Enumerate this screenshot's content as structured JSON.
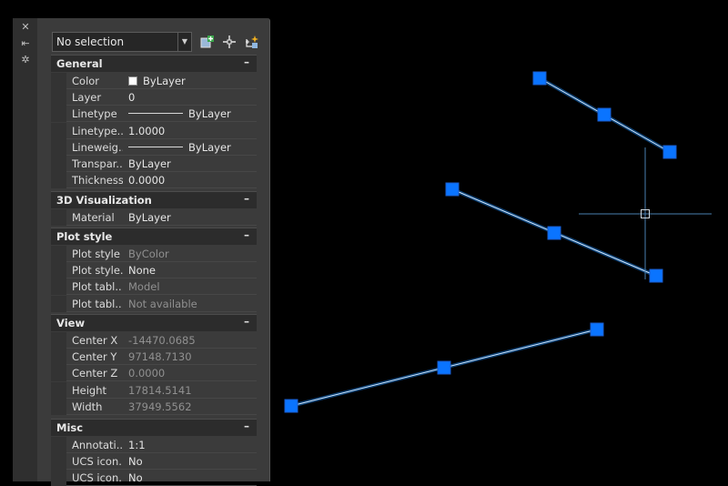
{
  "palette": {
    "titlebar_icons": [
      "close-icon",
      "auto-hide-icon",
      "properties-settings-icon"
    ],
    "selection": "No selection",
    "tools": [
      "toggle-pickadd-icon",
      "select-objects-icon",
      "quick-select-icon"
    ],
    "sections": [
      {
        "title": "General",
        "collapse": "–",
        "rows": [
          {
            "name": "Color",
            "value": "ByLayer",
            "swatch": true
          },
          {
            "name": "Layer",
            "value": "0"
          },
          {
            "name": "Linetype",
            "value": "ByLayer",
            "line": true
          },
          {
            "name": "Linetype...",
            "value": "1.0000"
          },
          {
            "name": "Lineweig...",
            "value": "ByLayer",
            "line": true
          },
          {
            "name": "Transpar...",
            "value": "ByLayer"
          },
          {
            "name": "Thickness",
            "value": "0.0000"
          }
        ]
      },
      {
        "title": "3D Visualization",
        "collapse": "–",
        "rows": [
          {
            "name": "Material",
            "value": "ByLayer"
          }
        ]
      },
      {
        "title": "Plot style",
        "collapse": "–",
        "rows": [
          {
            "name": "Plot style",
            "value": "ByColor",
            "dim": true
          },
          {
            "name": "Plot style...",
            "value": "None"
          },
          {
            "name": "Plot tabl...",
            "value": "Model",
            "dim": true
          },
          {
            "name": "Plot tabl...",
            "value": "Not available",
            "dim": true
          }
        ]
      },
      {
        "title": "View",
        "collapse": "–",
        "rows": [
          {
            "name": "Center X",
            "value": "-14470.0685",
            "dim": true
          },
          {
            "name": "Center Y",
            "value": "97148.7130",
            "dim": true
          },
          {
            "name": "Center Z",
            "value": "0.0000",
            "dim": true
          },
          {
            "name": "Height",
            "value": "17814.5141",
            "dim": true
          },
          {
            "name": "Width",
            "value": "37949.5562",
            "dim": true
          }
        ]
      },
      {
        "title": "Misc",
        "collapse": "–",
        "rows": [
          {
            "name": "Annotati...",
            "value": "1:1"
          },
          {
            "name": "UCS icon...",
            "value": "No"
          },
          {
            "name": "UCS icon...",
            "value": "No"
          }
        ]
      }
    ]
  },
  "drawing": {
    "line_color": "#1e90ff",
    "grip_color": "#0a74ff",
    "crosshair_color": "#4a7fb0",
    "lines": [
      {
        "name": "line-1"
      },
      {
        "name": "line-2"
      },
      {
        "name": "line-3"
      }
    ]
  }
}
